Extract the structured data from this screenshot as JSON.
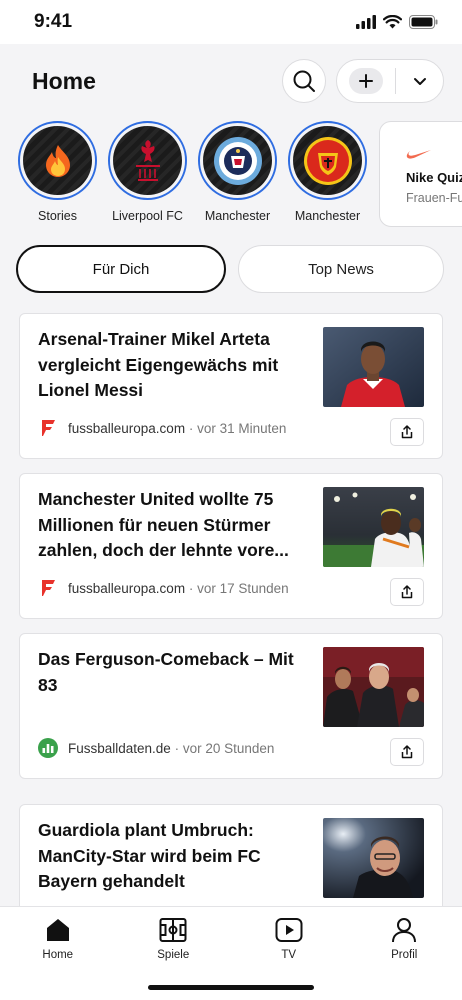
{
  "status": {
    "time": "9:41"
  },
  "header": {
    "title": "Home"
  },
  "stories": [
    {
      "label": "Stories"
    },
    {
      "label": "Liverpool FC"
    },
    {
      "label": "Manchester"
    },
    {
      "label": "Manchester"
    }
  ],
  "nike_card": {
    "title": "Nike Quiz",
    "subtitle": "Frauen-Fußball"
  },
  "tabs": [
    {
      "label": "Für Dich",
      "active": true
    },
    {
      "label": "Top News",
      "active": false
    }
  ],
  "articles": [
    {
      "headline": "Arsenal-Trainer Mikel Arteta vergleicht Eigengewächs mit Lionel Messi",
      "source": "fussballeuropa.com",
      "time": "vor 31 Minuten"
    },
    {
      "headline": "Manchester United wollte 75 Millionen für neuen Stürmer zahlen, doch der lehnte vore...",
      "source": "fussballeuropa.com",
      "time": "vor 17 Stunden"
    },
    {
      "headline": "Das Ferguson-Comeback – Mit 83",
      "source": "Fussballdaten.de",
      "time": "vor 20 Stunden"
    },
    {
      "headline": "Guardiola plant Umbruch: ManCity-Star wird beim FC Bayern gehandelt",
      "source": "",
      "time": ""
    }
  ],
  "meta_separator": "·",
  "bottom_nav": [
    {
      "label": "Home",
      "icon": "home-icon"
    },
    {
      "label": "Spiele",
      "icon": "pitch-icon"
    },
    {
      "label": "TV",
      "icon": "play-icon"
    },
    {
      "label": "Profil",
      "icon": "user-icon"
    }
  ],
  "colors": {
    "accent": "#2f6de1",
    "liverpool": "#c8102e",
    "mancity": "#6cabdd",
    "fussballdaten": "#3aa14b"
  }
}
